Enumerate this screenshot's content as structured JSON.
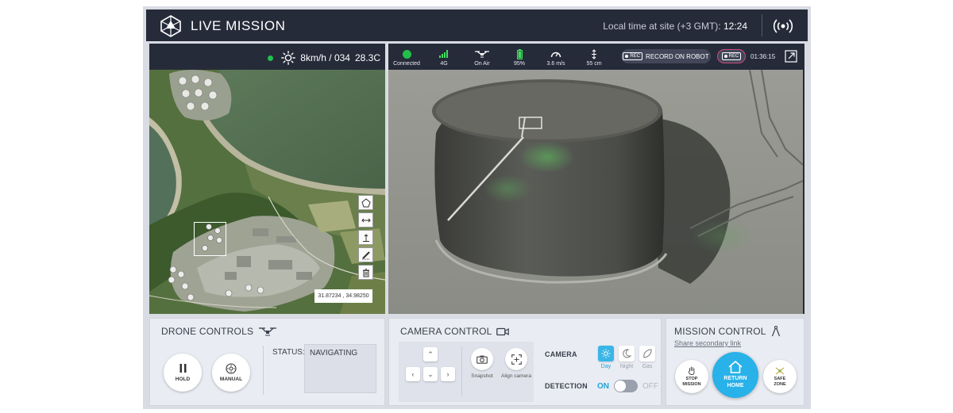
{
  "header": {
    "title": "LIVE MISSION",
    "local_time_label": "Local time at site (+3 GMT):",
    "local_time_value": "12:24"
  },
  "map_panel": {
    "weather": {
      "status_color": "#22c04a",
      "icon": "sun-icon",
      "wind": "8km/h / 034",
      "temperature": "28.3C"
    },
    "coordinates": "31.87234 , 34.98250",
    "tools": [
      "polygon-icon",
      "ruler-icon",
      "altitude-icon",
      "pencil-icon",
      "trash-icon"
    ]
  },
  "video_panel": {
    "stats": [
      {
        "icon": "connection-dot-icon",
        "label": "Connected"
      },
      {
        "icon": "signal-bars-icon",
        "label": "4G"
      },
      {
        "icon": "drone-icon",
        "label": "On Air"
      },
      {
        "icon": "battery-icon",
        "label": "95%"
      },
      {
        "icon": "speedometer-icon",
        "label": "3.6 m/s"
      },
      {
        "icon": "height-icon",
        "label": "55 cm"
      }
    ],
    "record_on_robot": "RECORD ON ROBOT",
    "rec_tag": "REC",
    "rec_button": "REC",
    "rec_time": "01:36:15"
  },
  "drone_controls": {
    "title": "DRONE CONTROLS",
    "hold_label": "HOLD",
    "manual_label": "MANUAL",
    "status_label": "STATUS:",
    "status_value": "NAVIGATING"
  },
  "camera_control": {
    "title": "CAMERA CONTROL",
    "snapshot_label": "Snapshot",
    "align_label": "Align camera",
    "camera_label": "CAMERA",
    "modes": [
      {
        "label": "Day",
        "active": true
      },
      {
        "label": "Night",
        "active": false
      },
      {
        "label": "Gas",
        "active": false
      }
    ],
    "detection_label": "DETECTION",
    "detection_on": "ON",
    "detection_off": "OFF"
  },
  "mission_control": {
    "title": "MISSION CONTROL",
    "share_link": "Share secondary link",
    "stop_line1": "STOP",
    "stop_line2": "MISSION",
    "return_line1": "RETURN",
    "return_line2": "HOME",
    "safe_line1": "SAFE",
    "safe_line2": "ZONE"
  },
  "colors": {
    "accent": "#29b1e9",
    "header_bg": "#262b3a",
    "rec_border": "#d1497d",
    "battery": "#3fdd5b"
  }
}
